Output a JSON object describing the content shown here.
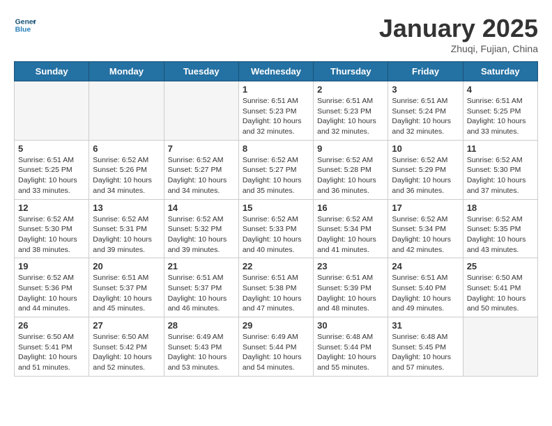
{
  "header": {
    "logo": {
      "line1": "General",
      "line2": "Blue"
    },
    "title": "January 2025",
    "subtitle": "Zhuqi, Fujian, China"
  },
  "weekdays": [
    "Sunday",
    "Monday",
    "Tuesday",
    "Wednesday",
    "Thursday",
    "Friday",
    "Saturday"
  ],
  "weeks": [
    [
      {
        "day": "",
        "empty": true
      },
      {
        "day": "",
        "empty": true
      },
      {
        "day": "",
        "empty": true
      },
      {
        "day": "1",
        "sunrise": "6:51 AM",
        "sunset": "5:23 PM",
        "daylight": "10 hours and 32 minutes."
      },
      {
        "day": "2",
        "sunrise": "6:51 AM",
        "sunset": "5:23 PM",
        "daylight": "10 hours and 32 minutes."
      },
      {
        "day": "3",
        "sunrise": "6:51 AM",
        "sunset": "5:24 PM",
        "daylight": "10 hours and 32 minutes."
      },
      {
        "day": "4",
        "sunrise": "6:51 AM",
        "sunset": "5:25 PM",
        "daylight": "10 hours and 33 minutes."
      }
    ],
    [
      {
        "day": "5",
        "sunrise": "6:51 AM",
        "sunset": "5:25 PM",
        "daylight": "10 hours and 33 minutes."
      },
      {
        "day": "6",
        "sunrise": "6:52 AM",
        "sunset": "5:26 PM",
        "daylight": "10 hours and 34 minutes."
      },
      {
        "day": "7",
        "sunrise": "6:52 AM",
        "sunset": "5:27 PM",
        "daylight": "10 hours and 34 minutes."
      },
      {
        "day": "8",
        "sunrise": "6:52 AM",
        "sunset": "5:27 PM",
        "daylight": "10 hours and 35 minutes."
      },
      {
        "day": "9",
        "sunrise": "6:52 AM",
        "sunset": "5:28 PM",
        "daylight": "10 hours and 36 minutes."
      },
      {
        "day": "10",
        "sunrise": "6:52 AM",
        "sunset": "5:29 PM",
        "daylight": "10 hours and 36 minutes."
      },
      {
        "day": "11",
        "sunrise": "6:52 AM",
        "sunset": "5:30 PM",
        "daylight": "10 hours and 37 minutes."
      }
    ],
    [
      {
        "day": "12",
        "sunrise": "6:52 AM",
        "sunset": "5:30 PM",
        "daylight": "10 hours and 38 minutes."
      },
      {
        "day": "13",
        "sunrise": "6:52 AM",
        "sunset": "5:31 PM",
        "daylight": "10 hours and 39 minutes."
      },
      {
        "day": "14",
        "sunrise": "6:52 AM",
        "sunset": "5:32 PM",
        "daylight": "10 hours and 39 minutes."
      },
      {
        "day": "15",
        "sunrise": "6:52 AM",
        "sunset": "5:33 PM",
        "daylight": "10 hours and 40 minutes."
      },
      {
        "day": "16",
        "sunrise": "6:52 AM",
        "sunset": "5:34 PM",
        "daylight": "10 hours and 41 minutes."
      },
      {
        "day": "17",
        "sunrise": "6:52 AM",
        "sunset": "5:34 PM",
        "daylight": "10 hours and 42 minutes."
      },
      {
        "day": "18",
        "sunrise": "6:52 AM",
        "sunset": "5:35 PM",
        "daylight": "10 hours and 43 minutes."
      }
    ],
    [
      {
        "day": "19",
        "sunrise": "6:52 AM",
        "sunset": "5:36 PM",
        "daylight": "10 hours and 44 minutes."
      },
      {
        "day": "20",
        "sunrise": "6:51 AM",
        "sunset": "5:37 PM",
        "daylight": "10 hours and 45 minutes."
      },
      {
        "day": "21",
        "sunrise": "6:51 AM",
        "sunset": "5:37 PM",
        "daylight": "10 hours and 46 minutes."
      },
      {
        "day": "22",
        "sunrise": "6:51 AM",
        "sunset": "5:38 PM",
        "daylight": "10 hours and 47 minutes."
      },
      {
        "day": "23",
        "sunrise": "6:51 AM",
        "sunset": "5:39 PM",
        "daylight": "10 hours and 48 minutes."
      },
      {
        "day": "24",
        "sunrise": "6:51 AM",
        "sunset": "5:40 PM",
        "daylight": "10 hours and 49 minutes."
      },
      {
        "day": "25",
        "sunrise": "6:50 AM",
        "sunset": "5:41 PM",
        "daylight": "10 hours and 50 minutes."
      }
    ],
    [
      {
        "day": "26",
        "sunrise": "6:50 AM",
        "sunset": "5:41 PM",
        "daylight": "10 hours and 51 minutes."
      },
      {
        "day": "27",
        "sunrise": "6:50 AM",
        "sunset": "5:42 PM",
        "daylight": "10 hours and 52 minutes."
      },
      {
        "day": "28",
        "sunrise": "6:49 AM",
        "sunset": "5:43 PM",
        "daylight": "10 hours and 53 minutes."
      },
      {
        "day": "29",
        "sunrise": "6:49 AM",
        "sunset": "5:44 PM",
        "daylight": "10 hours and 54 minutes."
      },
      {
        "day": "30",
        "sunrise": "6:48 AM",
        "sunset": "5:44 PM",
        "daylight": "10 hours and 55 minutes."
      },
      {
        "day": "31",
        "sunrise": "6:48 AM",
        "sunset": "5:45 PM",
        "daylight": "10 hours and 57 minutes."
      },
      {
        "day": "",
        "empty": true
      }
    ]
  ]
}
